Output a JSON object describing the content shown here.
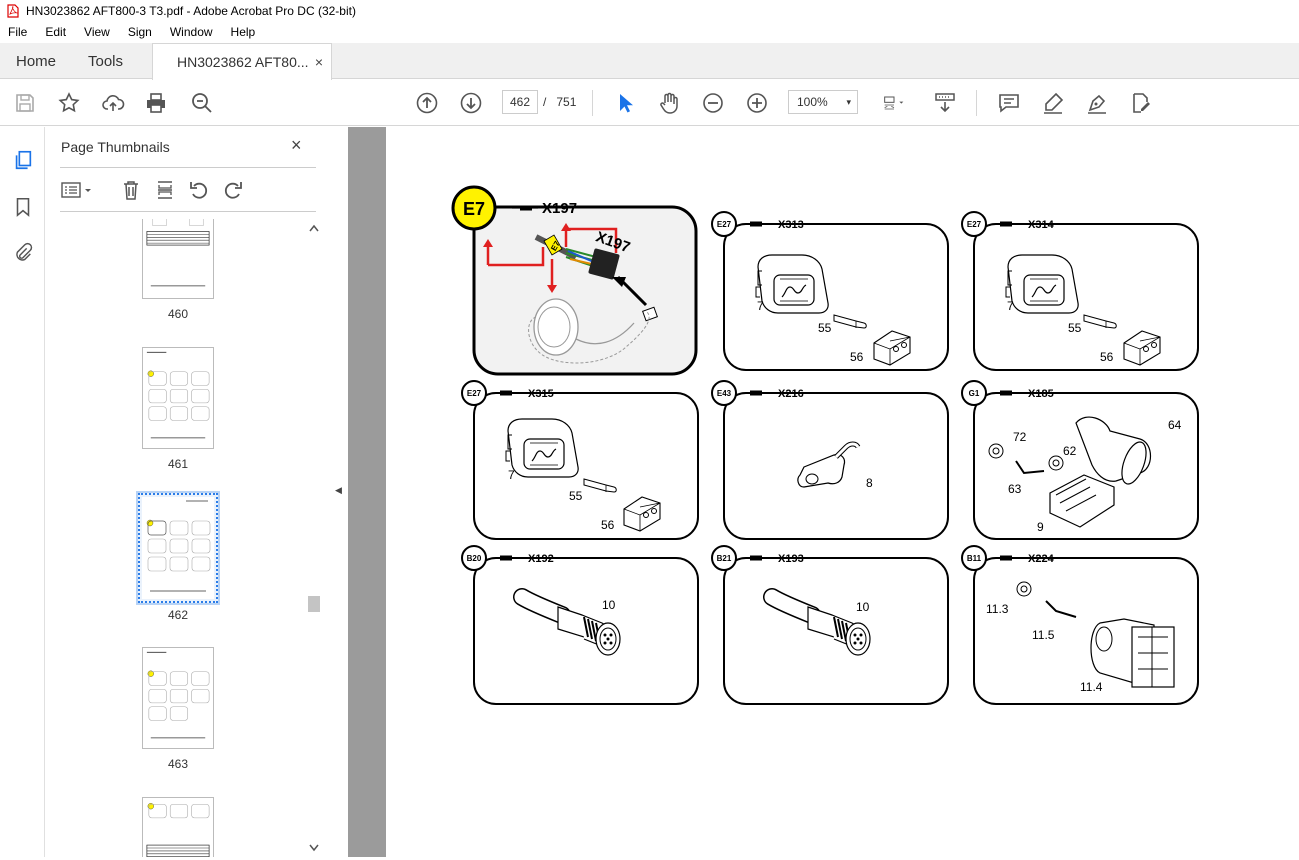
{
  "window": {
    "title": "HN3023862 AFT800-3 T3.pdf - Adobe Acrobat Pro DC (32-bit)"
  },
  "menu": [
    "File",
    "Edit",
    "View",
    "Sign",
    "Window",
    "Help"
  ],
  "tabs": {
    "home": "Home",
    "tools": "Tools",
    "doc": "HN3023862 AFT80...",
    "close": "×"
  },
  "toolbar": {
    "page_current": "462",
    "page_sep": "/",
    "page_total": "751",
    "zoom": "100%",
    "zoom_dd": "▾"
  },
  "panel": {
    "title": "Page Thumbnails",
    "close": "×",
    "thumbs": [
      "460",
      "461",
      "462",
      "463"
    ],
    "selected": "462"
  },
  "collapse_arrow": "◀",
  "figure": {
    "main": {
      "badge": "E7",
      "code": "X197",
      "callout_label": "E7",
      "callout_code": "X197"
    },
    "cells": [
      {
        "badge": "E27",
        "code": "X313",
        "labels": [
          "7",
          "55",
          "56"
        ]
      },
      {
        "badge": "E27",
        "code": "X314",
        "labels": [
          "7",
          "55",
          "56"
        ]
      },
      {
        "badge": "E27",
        "code": "X315",
        "labels": [
          "7",
          "55",
          "56"
        ]
      },
      {
        "badge": "E43",
        "code": "X216",
        "labels": [
          "8"
        ]
      },
      {
        "badge": "G1",
        "code": "X185",
        "labels": [
          "72",
          "62",
          "64",
          "63",
          "9"
        ]
      },
      {
        "badge": "B20",
        "code": "X192",
        "labels": [
          "10"
        ]
      },
      {
        "badge": "B21",
        "code": "X193",
        "labels": [
          "10"
        ]
      },
      {
        "badge": "B11",
        "code": "X224",
        "labels": [
          "11.3",
          "11.5",
          "11.4"
        ]
      }
    ]
  },
  "colors": {
    "accent_red": "#e02020",
    "badge_yellow": "#fff200",
    "selection_blue": "#2b7de9"
  }
}
